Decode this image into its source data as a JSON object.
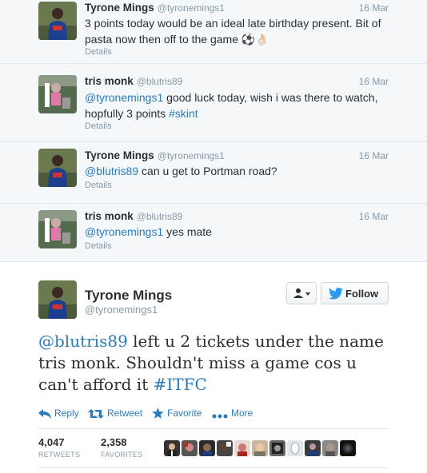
{
  "thread": [
    {
      "name": "Tyrone Mings",
      "handle": "@tyronemings1",
      "time": "16 Mar",
      "text": "3 points today would be an ideal late birthday present. Bit of pasta now then off to the game",
      "emoji": "⚽👌🏻",
      "details": "Details"
    },
    {
      "name": "tris monk",
      "handle": "@blutris89",
      "time": "16 Mar",
      "mention": "@tyronemings1",
      "text": " good luck today, wish i was there to watch, hopfully 3 points ",
      "hashtag": "#skint",
      "details": "Details"
    },
    {
      "name": "Tyrone Mings",
      "handle": "@tyronemings1",
      "time": "16 Mar",
      "mention": "@blutris89",
      "text": " can u get to Portman road?",
      "details": "Details"
    },
    {
      "name": "tris monk",
      "handle": "@blutris89",
      "time": "16 Mar",
      "mention": "@tyronemings1",
      "text": " yes mate",
      "details": "Details"
    }
  ],
  "main": {
    "name": "Tyrone Mings",
    "handle": "@tyronemings1",
    "follow_label": "Follow",
    "mention": "@blutris89",
    "text": " left u 2 tickets under the name tris monk. Shouldn't miss a game cos u can't afford it ",
    "hashtag": "#ITFC",
    "actions": {
      "reply": "Reply",
      "retweet": "Retweet",
      "favorite": "Favorite",
      "more": "More"
    },
    "stats": {
      "retweets": "4,047",
      "retweets_label": "RETWEETS",
      "favorites": "2,358",
      "favorites_label": "FAVORITES"
    }
  },
  "colors": {
    "link": "#2b7bb9",
    "muted": "#8899a6",
    "text": "#292f33",
    "thread_bg": "#f5f8fa"
  }
}
